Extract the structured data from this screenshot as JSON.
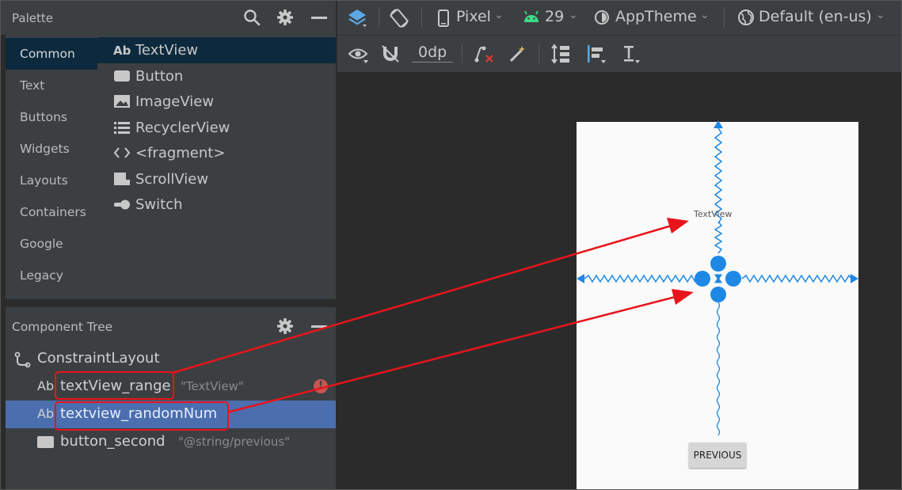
{
  "palette": {
    "title": "Palette",
    "categories": [
      "Common",
      "Text",
      "Buttons",
      "Widgets",
      "Layouts",
      "Containers",
      "Google",
      "Legacy"
    ],
    "selected_category": "Common",
    "widgets": [
      {
        "label": "TextView",
        "icon": "text-ab-icon"
      },
      {
        "label": "Button",
        "icon": "button-icon"
      },
      {
        "label": "ImageView",
        "icon": "image-icon"
      },
      {
        "label": "RecyclerView",
        "icon": "list-icon"
      },
      {
        "label": "<fragment>",
        "icon": "code-brackets-icon"
      },
      {
        "label": "ScrollView",
        "icon": "scrollview-icon"
      },
      {
        "label": "Switch",
        "icon": "switch-icon"
      }
    ]
  },
  "component_tree": {
    "title": "Component Tree",
    "root": "ConstraintLayout",
    "items": [
      {
        "prefix": "Ab",
        "name": "textView_range",
        "hint": "\"TextView\"",
        "warning": true
      },
      {
        "prefix": "Ab",
        "name": "textview_randomNum",
        "hint": "",
        "warning": false
      },
      {
        "prefix": "",
        "name": "button_second",
        "hint": "\"@string/previous\"",
        "warning": false
      }
    ]
  },
  "toolbar": {
    "device": "Pixel",
    "api": "29",
    "theme": "AppTheme",
    "locale": "Default (en-us)",
    "margin": "0dp"
  },
  "preview": {
    "textview_text": "TextView",
    "button_text": "PREVIOUS"
  },
  "colors": {
    "accent_blue": "#1e88e5",
    "annotation_red": "#e8141b",
    "selection": "#4b6eaf",
    "android_green": "#3ddc84"
  }
}
